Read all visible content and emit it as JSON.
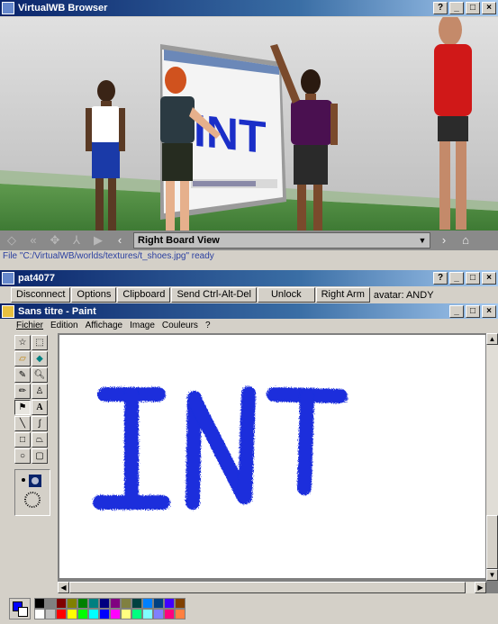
{
  "browser": {
    "title": "VirtualWB Browser",
    "window_controls": [
      "?■",
      "_",
      "□",
      "×"
    ],
    "viewpoint": "Right Board View",
    "status": "File \"C:/VirtualWB/worlds/textures/t_shoes.jpg\" ready",
    "scene": {
      "board_text": "INT"
    }
  },
  "vnc": {
    "title": "pat4077",
    "buttons": [
      "Disconnect",
      "Options",
      "Clipboard",
      "Send Ctrl-Alt-Del",
      "Unlock",
      "Right Arm"
    ],
    "avatar_label": "avatar: ANDY"
  },
  "paint": {
    "title": "Sans titre - Paint",
    "menu": [
      "Fichier",
      "Edition",
      "Affichage",
      "Image",
      "Couleurs",
      "?"
    ],
    "canvas_text": "INT",
    "tools": [
      "select-free",
      "select-rect",
      "eraser",
      "fill",
      "picker",
      "magnifier",
      "pencil",
      "brush",
      "airbrush",
      "text",
      "line",
      "curve",
      "rectangle",
      "polygon",
      "ellipse",
      "rounded-rectangle"
    ],
    "active_tool": "airbrush",
    "colors": {
      "foreground": "#0000ff",
      "background": "#ffffff",
      "palette_row1": [
        "#000000",
        "#808080",
        "#800000",
        "#808000",
        "#008000",
        "#008080",
        "#000080",
        "#800080",
        "#808040",
        "#004040",
        "#0080ff",
        "#004080",
        "#4000ff",
        "#804000"
      ],
      "palette_row2": [
        "#ffffff",
        "#c0c0c0",
        "#ff0000",
        "#ffff00",
        "#00ff00",
        "#00ffff",
        "#0000ff",
        "#ff00ff",
        "#ffff80",
        "#00ff80",
        "#80ffff",
        "#8080ff",
        "#ff0080",
        "#ff8040"
      ]
    }
  }
}
